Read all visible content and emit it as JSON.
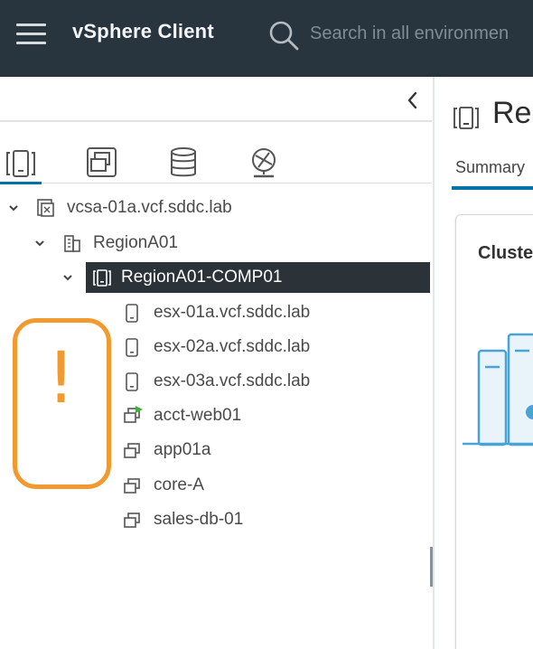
{
  "header": {
    "app_title": "vSphere Client",
    "search_placeholder": "Search in all environmen"
  },
  "navigator": {
    "tabs": [
      {
        "icon": "hosts-and-clusters-icon",
        "active": true
      },
      {
        "icon": "vms-and-templates-icon",
        "active": false
      },
      {
        "icon": "storage-icon",
        "active": false
      },
      {
        "icon": "networking-icon",
        "active": false
      }
    ],
    "tree": {
      "vcenter": "vcsa-01a.vcf.sddc.lab",
      "datacenter": "RegionA01",
      "cluster": "RegionA01-COMP01",
      "hosts": [
        "esx-01a.vcf.sddc.lab",
        "esx-02a.vcf.sddc.lab",
        "esx-03a.vcf.sddc.lab"
      ],
      "vms": [
        "acct-web01",
        "app01a",
        "core-A",
        "sales-db-01"
      ]
    },
    "warning_symbol": "!"
  },
  "content": {
    "title": "Reg",
    "tab_summary": "Summary",
    "card_title": "Cluste"
  },
  "colors": {
    "header_bg": "#28353f",
    "accent": "#0072a3",
    "selected_row": "#2b3238",
    "warning": "#f29a30",
    "powered_on": "#3db13d"
  }
}
